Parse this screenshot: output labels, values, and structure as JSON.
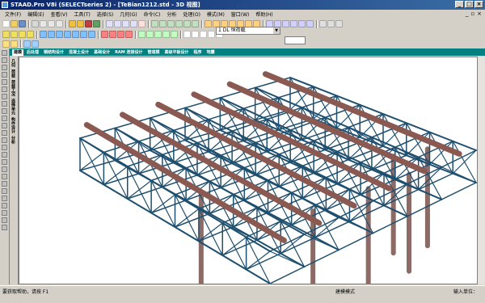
{
  "window": {
    "title": "STAAD.Pro V8i (SELECTseries 2) - [TeBian1212.std - 3D 视图]"
  },
  "menu": [
    "文件(F)",
    "编辑(E)",
    "查看(V)",
    "工具(T)",
    "选择(S)",
    "几何(G)",
    "命令(C)",
    "分析",
    "处理(O)",
    "模式(M)",
    "窗口(W)",
    "帮助(H)"
  ],
  "toolbar": {
    "load_case": "1 DL 恒荷载"
  },
  "tabs": [
    "建模",
    "后处理",
    "钢结构设计",
    "混凝土设计",
    "基础设计",
    "RAM 连接设计",
    "管道模",
    "高级平板设计",
    "程序",
    "地震"
  ],
  "side_tabs": [
    "几何",
    "荷载",
    "荷载工况",
    "选择单元",
    "构件设计",
    "分析"
  ],
  "status": {
    "left": "要获取帮助，请按 F1",
    "mode": "建模模式",
    "units": "输入单位："
  },
  "colors": {
    "truss": "#1f4f6e",
    "beam": "#8a5a52",
    "column": "#8c6a66",
    "teal_tab": "#008080"
  }
}
